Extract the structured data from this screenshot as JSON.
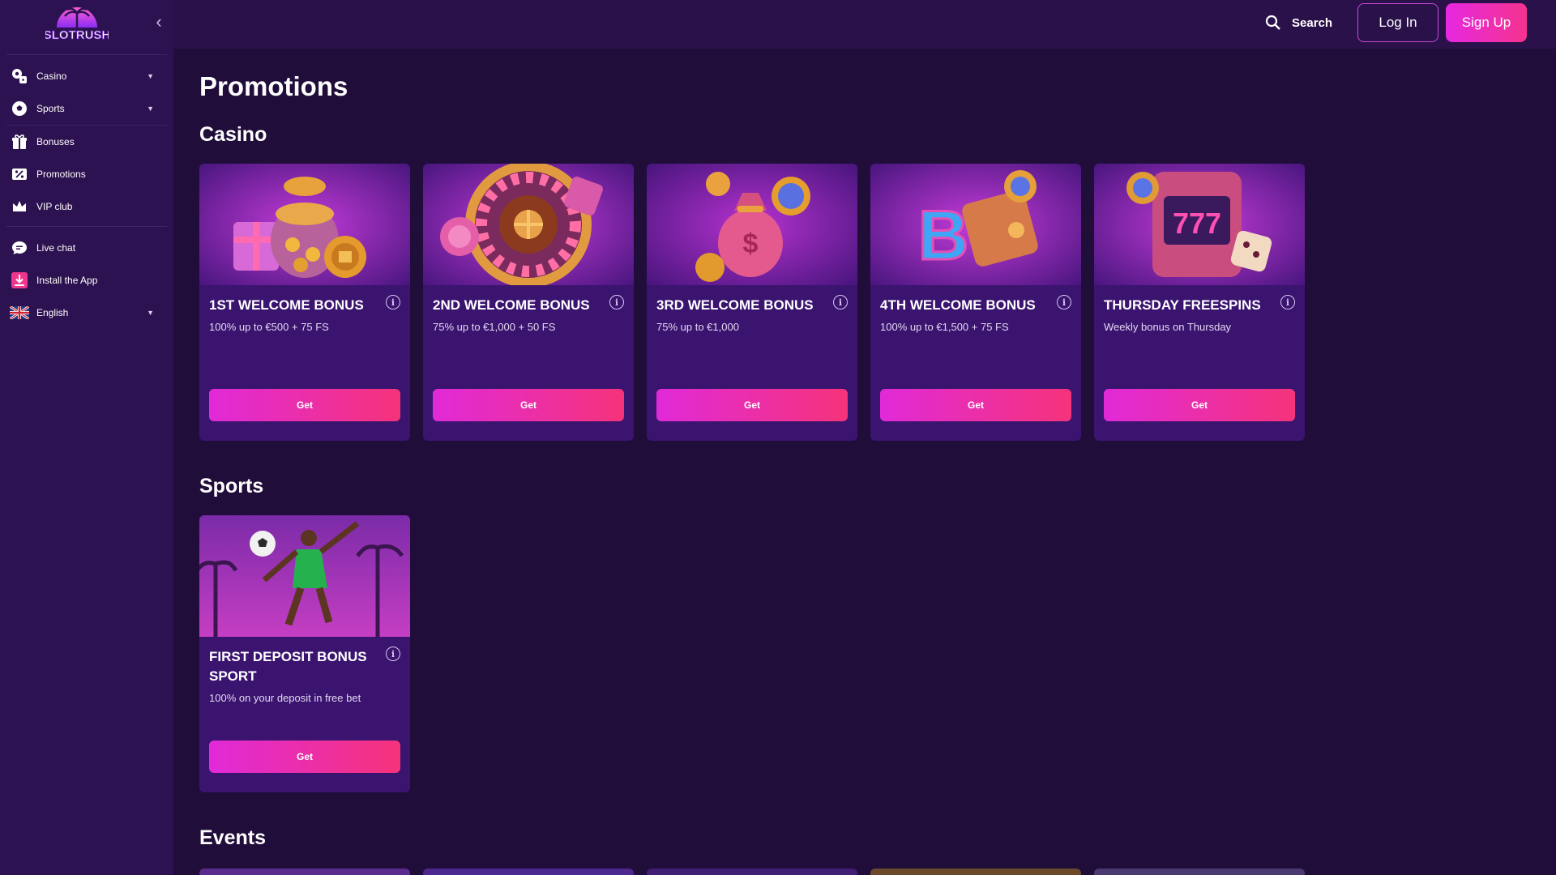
{
  "brand": {
    "logo_text": "SLOTRUSH"
  },
  "sidebar": {
    "items": [
      {
        "label": "Casino",
        "icon": "casino-chips-icon",
        "has_dropdown": true
      },
      {
        "label": "Sports",
        "icon": "soccer-ball-icon",
        "has_dropdown": true
      },
      {
        "label": "Bonuses",
        "icon": "gift-icon",
        "has_dropdown": false
      },
      {
        "label": "Promotions",
        "icon": "percent-ticket-icon",
        "has_dropdown": false
      },
      {
        "label": "VIP club",
        "icon": "crown-icon",
        "has_dropdown": false
      },
      {
        "label": "Live chat",
        "icon": "chat-bubble-icon",
        "has_dropdown": false
      },
      {
        "label": "Install the App",
        "icon": "download-icon",
        "has_dropdown": false
      },
      {
        "label": "English",
        "icon": "uk-flag-icon",
        "has_dropdown": true
      }
    ]
  },
  "header": {
    "search_label": "Search",
    "login_label": "Log In",
    "signup_label": "Sign Up"
  },
  "main": {
    "page_title": "Promotions",
    "sections": {
      "casino": {
        "title": "Casino",
        "cards": [
          {
            "title": "1ST WELCOME BONUS",
            "desc": "100% up to €500 + 75 FS",
            "button": "Get"
          },
          {
            "title": "2ND WELCOME BONUS",
            "desc": "75% up to €1,000 + 50 FS",
            "button": "Get"
          },
          {
            "title": "3RD WELCOME BONUS",
            "desc": "75% up to €1,000",
            "button": "Get"
          },
          {
            "title": "4TH WELCOME BONUS",
            "desc": "100% up to €1,500 + 75 FS",
            "button": "Get"
          },
          {
            "title": "THURSDAY FREESPINS",
            "desc": "Weekly bonus on Thursday",
            "button": "Get"
          }
        ]
      },
      "sports": {
        "title": "Sports",
        "cards": [
          {
            "title": "FIRST DEPOSIT BONUS SPORT",
            "desc": "100% on your deposit in free bet",
            "button": "Get"
          }
        ]
      },
      "events": {
        "title": "Events"
      }
    }
  },
  "colors": {
    "background": "#200d3a",
    "sidebar": "#2c1250",
    "card": "#3b1470",
    "accent_pink": "#e628e0",
    "accent_red_pink": "#f5337a"
  }
}
